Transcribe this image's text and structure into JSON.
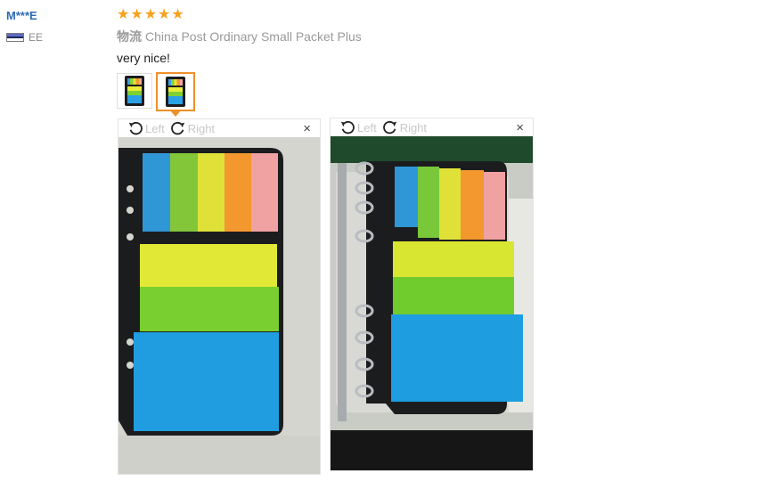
{
  "reviewer": {
    "name": "M***E",
    "country_code": "EE"
  },
  "rating": {
    "stars": 5,
    "max": 5,
    "color": "#f7a21d"
  },
  "logistics": {
    "label": "物流",
    "value": "China Post Ordinary Small Packet Plus"
  },
  "review_text": "very nice!",
  "thumbnails": {
    "count": 2,
    "active_index": 1
  },
  "viewers": [
    {
      "rotate_left": "Left",
      "rotate_right": "Right",
      "close": "×"
    },
    {
      "rotate_left": "Left",
      "rotate_right": "Right",
      "close": "×"
    }
  ],
  "colors": {
    "accent": "#f08f28",
    "username": "#2d6bb4"
  }
}
